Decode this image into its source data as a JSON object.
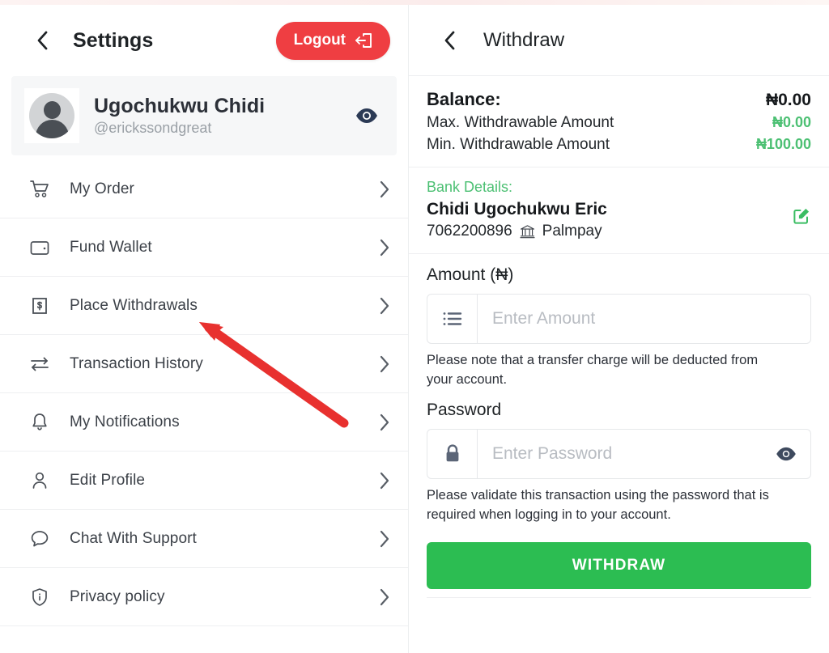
{
  "settings": {
    "title": "Settings",
    "back_icon": "chevron-left-icon",
    "logout_label": "Logout",
    "logout_icon": "logout-arrow-icon",
    "logout_color": "#ef3e42",
    "profile": {
      "name": "Ugochukwu Chidi",
      "handle": "@erickssondgreat",
      "avatar_icon": "user-avatar-icon",
      "visibility_icon": "eye-icon"
    },
    "menu": [
      {
        "label": "My Order",
        "icon": "shopping-cart-icon",
        "chevron": "chevron-right-icon"
      },
      {
        "label": "Fund Wallet",
        "icon": "wallet-icon",
        "chevron": "chevron-right-icon"
      },
      {
        "label": "Place Withdrawals",
        "icon": "money-bill-icon",
        "chevron": "chevron-right-icon"
      },
      {
        "label": "Transaction History",
        "icon": "transfer-arrows-icon",
        "chevron": "chevron-right-icon"
      },
      {
        "label": "My Notifications",
        "icon": "bell-icon",
        "chevron": "chevron-right-icon"
      },
      {
        "label": "Edit Profile",
        "icon": "person-icon",
        "chevron": "chevron-right-icon"
      },
      {
        "label": "Chat With Support",
        "icon": "chat-bubble-icon",
        "chevron": "chevron-right-icon"
      },
      {
        "label": "Privacy policy",
        "icon": "shield-info-icon",
        "chevron": "chevron-right-icon"
      }
    ],
    "annotation": {
      "type": "red-arrow",
      "color": "#e8312f",
      "points_to": "Place Withdrawals"
    }
  },
  "withdraw": {
    "title": "Withdraw",
    "back_icon": "chevron-left-icon",
    "balance": {
      "label": "Balance:",
      "value": "₦0.00",
      "max_label": "Max. Withdrawable Amount",
      "max_value": "₦0.00",
      "min_label": "Min. Withdrawable Amount",
      "min_value": "₦100.00",
      "accent_color": "#4cc073"
    },
    "bank": {
      "title": "Bank Details:",
      "account_name": "Chidi Ugochukwu Eric",
      "account_number": "7062200896",
      "bank_name": "Palmpay",
      "bank_icon": "bank-building-icon",
      "edit_icon": "edit-square-icon",
      "edit_color": "#3bbd63"
    },
    "amount": {
      "label": "Amount (₦)",
      "icon": "list-icon",
      "value": "",
      "placeholder": "Enter Amount",
      "helper": "Please note that a transfer charge will be deducted from your account."
    },
    "password": {
      "label": "Password",
      "icon": "lock-icon",
      "value": "",
      "placeholder": "Enter Password",
      "toggle_icon": "eye-icon",
      "helper": "Please validate this transaction using the password that is required when logging in to your account."
    },
    "submit_label": "WITHDRAW",
    "submit_color": "#2cbd52"
  }
}
